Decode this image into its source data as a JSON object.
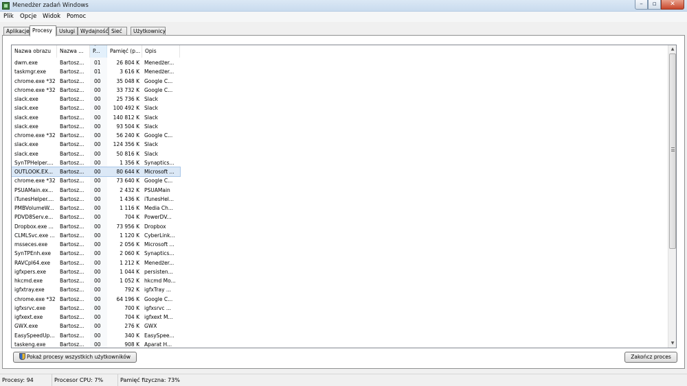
{
  "window": {
    "title": "Menedżer zadań Windows",
    "minimize": "–",
    "maximize": "▫",
    "close": "✕"
  },
  "menu": [
    "Plik",
    "Opcje",
    "Widok",
    "Pomoc"
  ],
  "tabs": [
    {
      "label": "Aplikacje",
      "active": false
    },
    {
      "label": "Procesy",
      "active": true
    },
    {
      "label": "Usługi",
      "active": false
    },
    {
      "label": "Wydajność",
      "active": false
    },
    {
      "label": "Sieć",
      "active": false
    },
    {
      "label": "Użytkownicy",
      "active": false
    }
  ],
  "columns": [
    "Nazwa obrazu",
    "Nazwa ...",
    "P...",
    "Pamięć (p...",
    "Opis"
  ],
  "rows": [
    [
      "dwm.exe",
      "Bartosz...",
      "01",
      "26 804 K",
      "Menedżer..."
    ],
    [
      "taskmgr.exe",
      "Bartosz...",
      "01",
      "3 616 K",
      "Menedżer..."
    ],
    [
      "chrome.exe *32",
      "Bartosz...",
      "00",
      "35 048 K",
      "Google C..."
    ],
    [
      "chrome.exe *32",
      "Bartosz...",
      "00",
      "33 732 K",
      "Google C..."
    ],
    [
      "slack.exe",
      "Bartosz...",
      "00",
      "25 736 K",
      "Slack"
    ],
    [
      "slack.exe",
      "Bartosz...",
      "00",
      "100 492 K",
      "Slack"
    ],
    [
      "slack.exe",
      "Bartosz...",
      "00",
      "140 812 K",
      "Slack"
    ],
    [
      "slack.exe",
      "Bartosz...",
      "00",
      "93 504 K",
      "Slack"
    ],
    [
      "chrome.exe *32",
      "Bartosz...",
      "00",
      "56 240 K",
      "Google C..."
    ],
    [
      "slack.exe",
      "Bartosz...",
      "00",
      "124 356 K",
      "Slack"
    ],
    [
      "slack.exe",
      "Bartosz...",
      "00",
      "50 816 K",
      "Slack"
    ],
    [
      "SynTPHelper....",
      "Bartosz...",
      "00",
      "1 356 K",
      "Synaptics..."
    ],
    [
      "OUTLOOK.EX...",
      "Bartosz...",
      "00",
      "80 644 K",
      "Microsoft ..."
    ],
    [
      "chrome.exe *32",
      "Bartosz...",
      "00",
      "73 640 K",
      "Google C..."
    ],
    [
      "PSUAMain.ex...",
      "Bartosz...",
      "00",
      "2 432 K",
      "PSUAMain"
    ],
    [
      "iTunesHelper....",
      "Bartosz...",
      "00",
      "1 436 K",
      "iTunesHel..."
    ],
    [
      "PMBVolumeW...",
      "Bartosz...",
      "00",
      "1 116 K",
      "Media Ch..."
    ],
    [
      "PDVD8Serv.e...",
      "Bartosz...",
      "00",
      "704 K",
      "PowerDV..."
    ],
    [
      "Dropbox.exe ...",
      "Bartosz...",
      "00",
      "73 956 K",
      "Dropbox"
    ],
    [
      "CLMLSvc.exe ...",
      "Bartosz...",
      "00",
      "1 120 K",
      "CyberLink..."
    ],
    [
      "msseces.exe",
      "Bartosz...",
      "00",
      "2 056 K",
      "Microsoft ..."
    ],
    [
      "SynTPEnh.exe",
      "Bartosz...",
      "00",
      "2 060 K",
      "Synaptics..."
    ],
    [
      "RAVCpl64.exe",
      "Bartosz...",
      "00",
      "1 212 K",
      "Menedżer..."
    ],
    [
      "igfxpers.exe",
      "Bartosz...",
      "00",
      "1 044 K",
      "persisten..."
    ],
    [
      "hkcmd.exe",
      "Bartosz...",
      "00",
      "1 052 K",
      "hkcmd Mo..."
    ],
    [
      "igfxtray.exe",
      "Bartosz...",
      "00",
      "792 K",
      "igfxTray ..."
    ],
    [
      "chrome.exe *32",
      "Bartosz...",
      "00",
      "64 196 K",
      "Google C..."
    ],
    [
      "igfxsrvc.exe",
      "Bartosz...",
      "00",
      "700 K",
      "igfxsrvc ..."
    ],
    [
      "igfxext.exe",
      "Bartosz...",
      "00",
      "704 K",
      "igfxext M..."
    ],
    [
      "GWX.exe",
      "Bartosz...",
      "00",
      "276 K",
      "GWX"
    ],
    [
      "EasySpeedUp...",
      "Bartosz...",
      "00",
      "340 K",
      "EasySpee..."
    ],
    [
      "taskeng.exe",
      "Bartosz...",
      "00",
      "908 K",
      "Aparat H..."
    ]
  ],
  "selected_row_index": 12,
  "buttons": {
    "show_all": "Pokaż procesy wszystkich użytkowników",
    "end_process": "Zakończ proces"
  },
  "status": {
    "processes": "Procesy: 94",
    "cpu": "Procesor CPU: 7%",
    "memory": "Pamięć fizyczna: 73%"
  },
  "colors": {
    "selection": "#dbe8f6",
    "sorted_column": "#e3f0fb",
    "close_button": "#c7472b"
  }
}
